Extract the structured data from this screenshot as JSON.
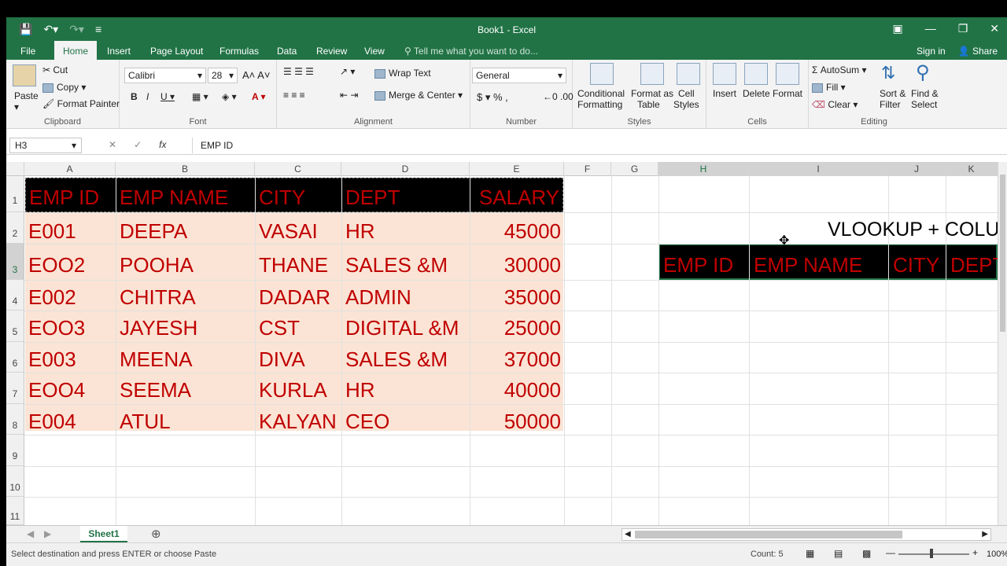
{
  "window": {
    "title": "Book1 - Excel"
  },
  "tabs": {
    "file": "File",
    "home": "Home",
    "insert": "Insert",
    "page_layout": "Page Layout",
    "formulas": "Formulas",
    "data": "Data",
    "review": "Review",
    "view": "View",
    "tell_me": "Tell me what you want to do...",
    "signin": "Sign in",
    "share": "Share"
  },
  "ribbon": {
    "clipboard": {
      "paste": "Paste",
      "cut": "Cut",
      "copy": "Copy",
      "format_painter": "Format Painter",
      "label": "Clipboard"
    },
    "font": {
      "name": "Calibri",
      "size": "28",
      "label": "Font"
    },
    "alignment": {
      "wrap": "Wrap Text",
      "merge": "Merge & Center",
      "label": "Alignment"
    },
    "number": {
      "format": "General",
      "label": "Number"
    },
    "styles": {
      "cond": "Conditional",
      "cond2": "Formatting",
      "fmt_table": "Format as",
      "fmt_table2": "Table",
      "cell_styles": "Cell",
      "cell_styles2": "Styles",
      "label": "Styles"
    },
    "cells": {
      "insert": "Insert",
      "delete": "Delete",
      "format": "Format",
      "label": "Cells"
    },
    "editing": {
      "autosum": "AutoSum",
      "fill": "Fill",
      "clear": "Clear",
      "sort": "Sort &",
      "sort2": "Filter",
      "find": "Find &",
      "find2": "Select",
      "label": "Editing"
    }
  },
  "formula_bar": {
    "name_box": "H3",
    "value": "EMP ID"
  },
  "columns": [
    "A",
    "B",
    "C",
    "D",
    "E",
    "F",
    "G",
    "H",
    "I",
    "J",
    "K"
  ],
  "rows": [
    "1",
    "2",
    "3",
    "4",
    "5",
    "6",
    "7",
    "8",
    "9",
    "10",
    "11"
  ],
  "table": {
    "headers": [
      "EMP ID",
      "EMP NAME",
      "CITY",
      "DEPT",
      "SALARY"
    ],
    "records": [
      [
        "E001",
        "DEEPA",
        "VASAI",
        "HR",
        "45000"
      ],
      [
        "EOO2",
        "POOHA",
        "THANE",
        "SALES &M",
        "30000"
      ],
      [
        "E002",
        "CHITRA",
        "DADAR",
        "ADMIN",
        "35000"
      ],
      [
        "EOO3",
        "JAYESH",
        "CST",
        "DIGITAL &M",
        "25000"
      ],
      [
        "E003",
        "MEENA",
        "DIVA",
        "SALES &M",
        "37000"
      ],
      [
        "EOO4",
        "SEEMA",
        "KURLA",
        "HR",
        "40000"
      ],
      [
        "E004",
        "ATUL",
        "KALYAN",
        "CEO",
        "50000"
      ]
    ]
  },
  "lookup": {
    "title": "VLOOKUP + COLU",
    "headers": [
      "EMP ID",
      "EMP NAME",
      "CITY",
      "DEPT"
    ]
  },
  "sheet": {
    "name": "Sheet1"
  },
  "status": {
    "message": "Select destination and press ENTER or choose Paste",
    "count": "Count: 5",
    "zoom": "100%"
  },
  "colors": {
    "accent": "#217346",
    "text_red": "#c00000",
    "table_fill": "#fbe4d5"
  }
}
